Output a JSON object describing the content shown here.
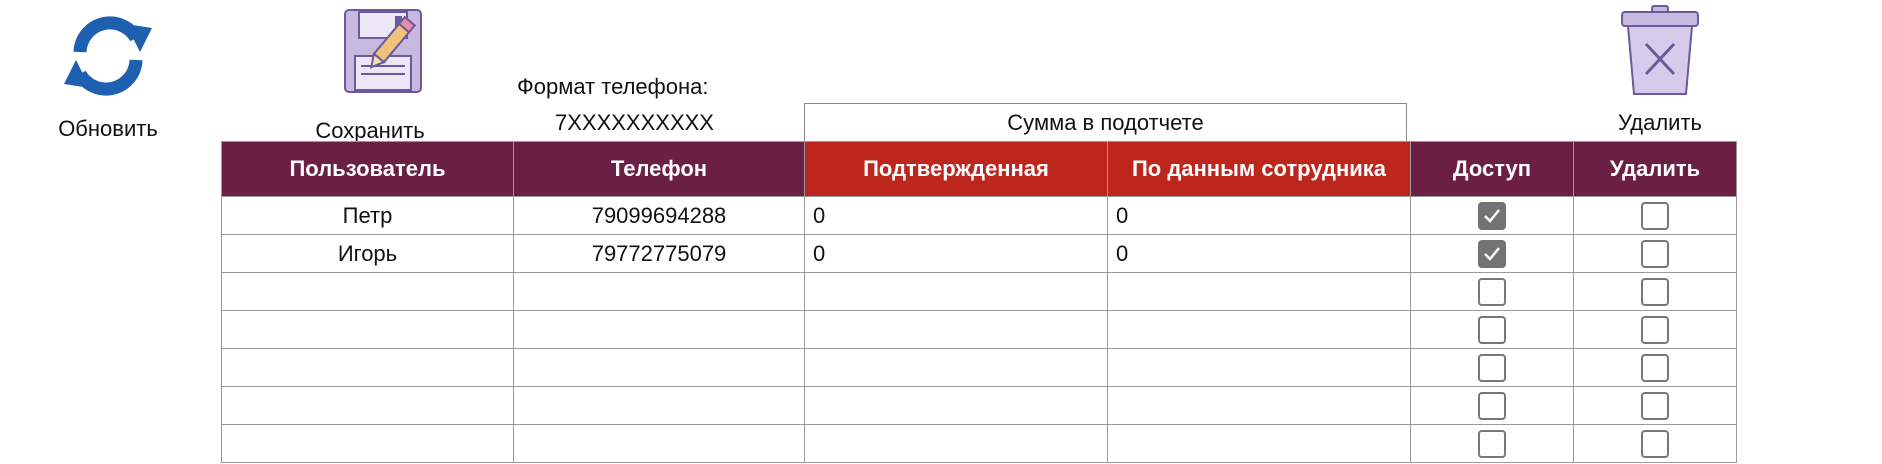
{
  "toolbar": {
    "refresh_label": "Обновить",
    "save_label": "Сохранить",
    "delete_label": "Удалить"
  },
  "phone_format": {
    "title": "Формат телефона:",
    "value": "7XXXXXXXXXX"
  },
  "table": {
    "group_header": "Сумма в подотчете",
    "headers": {
      "user": "Пользователь",
      "phone": "Телефон",
      "confirmed": "Подтвержденная",
      "employee_data": "По данным сотрудника",
      "access": "Доступ",
      "delete": "Удалить"
    },
    "rows": [
      {
        "user": "Петр",
        "phone": "79099694288",
        "confirmed": "0",
        "employee_data": "0",
        "access": true,
        "delete": false
      },
      {
        "user": "Игорь",
        "phone": "79772775079",
        "confirmed": "0",
        "employee_data": "0",
        "access": true,
        "delete": false
      },
      {
        "user": "",
        "phone": "",
        "confirmed": "",
        "employee_data": "",
        "access": false,
        "delete": false
      },
      {
        "user": "",
        "phone": "",
        "confirmed": "",
        "employee_data": "",
        "access": false,
        "delete": false
      },
      {
        "user": "",
        "phone": "",
        "confirmed": "",
        "employee_data": "",
        "access": false,
        "delete": false
      },
      {
        "user": "",
        "phone": "",
        "confirmed": "",
        "employee_data": "",
        "access": false,
        "delete": false
      },
      {
        "user": "",
        "phone": "",
        "confirmed": "",
        "employee_data": "",
        "access": false,
        "delete": false
      }
    ]
  },
  "colors": {
    "header_purple": "#6b1f45",
    "header_red": "#bd261c",
    "refresh_blue": "#1f5fb0",
    "icon_purple": "#b9a8d6",
    "checkbox_gray": "#737373"
  },
  "icons": {
    "refresh": "refresh-icon",
    "save": "floppy-pencil-icon",
    "delete": "trash-icon",
    "check": "check-icon"
  }
}
